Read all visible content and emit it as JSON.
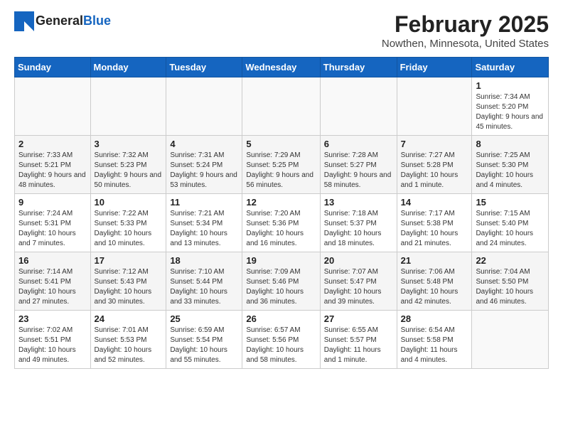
{
  "logo": {
    "line1": "General",
    "line2": "Blue"
  },
  "title": "February 2025",
  "location": "Nowthen, Minnesota, United States",
  "days_of_week": [
    "Sunday",
    "Monday",
    "Tuesday",
    "Wednesday",
    "Thursday",
    "Friday",
    "Saturday"
  ],
  "weeks": [
    [
      {
        "day": "",
        "info": ""
      },
      {
        "day": "",
        "info": ""
      },
      {
        "day": "",
        "info": ""
      },
      {
        "day": "",
        "info": ""
      },
      {
        "day": "",
        "info": ""
      },
      {
        "day": "",
        "info": ""
      },
      {
        "day": "1",
        "info": "Sunrise: 7:34 AM\nSunset: 5:20 PM\nDaylight: 9 hours and 45 minutes."
      }
    ],
    [
      {
        "day": "2",
        "info": "Sunrise: 7:33 AM\nSunset: 5:21 PM\nDaylight: 9 hours and 48 minutes."
      },
      {
        "day": "3",
        "info": "Sunrise: 7:32 AM\nSunset: 5:23 PM\nDaylight: 9 hours and 50 minutes."
      },
      {
        "day": "4",
        "info": "Sunrise: 7:31 AM\nSunset: 5:24 PM\nDaylight: 9 hours and 53 minutes."
      },
      {
        "day": "5",
        "info": "Sunrise: 7:29 AM\nSunset: 5:25 PM\nDaylight: 9 hours and 56 minutes."
      },
      {
        "day": "6",
        "info": "Sunrise: 7:28 AM\nSunset: 5:27 PM\nDaylight: 9 hours and 58 minutes."
      },
      {
        "day": "7",
        "info": "Sunrise: 7:27 AM\nSunset: 5:28 PM\nDaylight: 10 hours and 1 minute."
      },
      {
        "day": "8",
        "info": "Sunrise: 7:25 AM\nSunset: 5:30 PM\nDaylight: 10 hours and 4 minutes."
      }
    ],
    [
      {
        "day": "9",
        "info": "Sunrise: 7:24 AM\nSunset: 5:31 PM\nDaylight: 10 hours and 7 minutes."
      },
      {
        "day": "10",
        "info": "Sunrise: 7:22 AM\nSunset: 5:33 PM\nDaylight: 10 hours and 10 minutes."
      },
      {
        "day": "11",
        "info": "Sunrise: 7:21 AM\nSunset: 5:34 PM\nDaylight: 10 hours and 13 minutes."
      },
      {
        "day": "12",
        "info": "Sunrise: 7:20 AM\nSunset: 5:36 PM\nDaylight: 10 hours and 16 minutes."
      },
      {
        "day": "13",
        "info": "Sunrise: 7:18 AM\nSunset: 5:37 PM\nDaylight: 10 hours and 18 minutes."
      },
      {
        "day": "14",
        "info": "Sunrise: 7:17 AM\nSunset: 5:38 PM\nDaylight: 10 hours and 21 minutes."
      },
      {
        "day": "15",
        "info": "Sunrise: 7:15 AM\nSunset: 5:40 PM\nDaylight: 10 hours and 24 minutes."
      }
    ],
    [
      {
        "day": "16",
        "info": "Sunrise: 7:14 AM\nSunset: 5:41 PM\nDaylight: 10 hours and 27 minutes."
      },
      {
        "day": "17",
        "info": "Sunrise: 7:12 AM\nSunset: 5:43 PM\nDaylight: 10 hours and 30 minutes."
      },
      {
        "day": "18",
        "info": "Sunrise: 7:10 AM\nSunset: 5:44 PM\nDaylight: 10 hours and 33 minutes."
      },
      {
        "day": "19",
        "info": "Sunrise: 7:09 AM\nSunset: 5:46 PM\nDaylight: 10 hours and 36 minutes."
      },
      {
        "day": "20",
        "info": "Sunrise: 7:07 AM\nSunset: 5:47 PM\nDaylight: 10 hours and 39 minutes."
      },
      {
        "day": "21",
        "info": "Sunrise: 7:06 AM\nSunset: 5:48 PM\nDaylight: 10 hours and 42 minutes."
      },
      {
        "day": "22",
        "info": "Sunrise: 7:04 AM\nSunset: 5:50 PM\nDaylight: 10 hours and 46 minutes."
      }
    ],
    [
      {
        "day": "23",
        "info": "Sunrise: 7:02 AM\nSunset: 5:51 PM\nDaylight: 10 hours and 49 minutes."
      },
      {
        "day": "24",
        "info": "Sunrise: 7:01 AM\nSunset: 5:53 PM\nDaylight: 10 hours and 52 minutes."
      },
      {
        "day": "25",
        "info": "Sunrise: 6:59 AM\nSunset: 5:54 PM\nDaylight: 10 hours and 55 minutes."
      },
      {
        "day": "26",
        "info": "Sunrise: 6:57 AM\nSunset: 5:56 PM\nDaylight: 10 hours and 58 minutes."
      },
      {
        "day": "27",
        "info": "Sunrise: 6:55 AM\nSunset: 5:57 PM\nDaylight: 11 hours and 1 minute."
      },
      {
        "day": "28",
        "info": "Sunrise: 6:54 AM\nSunset: 5:58 PM\nDaylight: 11 hours and 4 minutes."
      },
      {
        "day": "",
        "info": ""
      }
    ]
  ]
}
